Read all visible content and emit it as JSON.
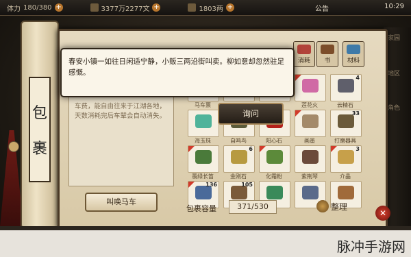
{
  "status": {
    "power_label": "体力",
    "power_value": "180/380",
    "gold": "3377万2277文",
    "gems": "1803两",
    "notice": "公告",
    "time": "10:29"
  },
  "roll_title": [
    "包",
    "裹"
  ],
  "tooltip": "春安小镇一如往日闲适宁静，小贩三两沿街叫卖。柳如意却忽然驻足感慨。",
  "ask_button": "询问",
  "item_desc": "车费，能自由往来于江湖各地，天数消耗完后车辇会自动消失。",
  "summon_button": "叫唤马车",
  "tabs": [
    {
      "label": "消耗",
      "color": "#b2433a"
    },
    {
      "label": "书",
      "color": "#7c4d2a"
    },
    {
      "label": "材料",
      "color": "#3f7aa8"
    }
  ],
  "items": [
    {
      "name": "马车票",
      "count": "",
      "new": true,
      "color": "#c8a15a"
    },
    {
      "name": "",
      "count": "",
      "new": true,
      "color": "#c04a6b"
    },
    {
      "name": "",
      "count": "",
      "new": false,
      "color": "#5a4a3a"
    },
    {
      "name": "莲花火",
      "count": "",
      "new": true,
      "color": "#d06aa5"
    },
    {
      "name": "云精石",
      "count": "4",
      "new": false,
      "color": "#5f5f6b"
    },
    {
      "name": "海玉珠",
      "count": "",
      "new": false,
      "color": "#4fb39a"
    },
    {
      "name": "自鸣鸟",
      "count": "",
      "new": true,
      "color": "#5b5b3a"
    },
    {
      "name": "阳心石",
      "count": "",
      "new": false,
      "color": "#b3201a"
    },
    {
      "name": "画墨",
      "count": "",
      "new": true,
      "color": "#a48a6a"
    },
    {
      "name": "打磨器具",
      "count": "33",
      "new": false,
      "color": "#6b5a3a"
    },
    {
      "name": "翡绿长笛",
      "count": "",
      "new": true,
      "color": "#4a7a3a"
    },
    {
      "name": "金刚石",
      "count": "6",
      "new": false,
      "color": "#b79a40"
    },
    {
      "name": "化霜粉",
      "count": "",
      "new": true,
      "color": "#5c8a3a"
    },
    {
      "name": "紫荆琴",
      "count": "",
      "new": false,
      "color": "#6b4a3a"
    },
    {
      "name": "介晶",
      "count": "3",
      "new": true,
      "color": "#c7a04a"
    },
    {
      "name": "",
      "count": "136",
      "new": true,
      "color": "#4a6a9a"
    },
    {
      "name": "",
      "count": "105",
      "new": false,
      "color": "#7a5a3a"
    },
    {
      "name": "",
      "count": "",
      "new": false,
      "color": "#3a8a5a"
    },
    {
      "name": "",
      "count": "",
      "new": false,
      "color": "#5a6a8a"
    },
    {
      "name": "",
      "count": "",
      "new": false,
      "color": "#a06a3a"
    }
  ],
  "capacity_label": "包裹容量",
  "capacity_value": "371/530",
  "sort_button": "整理",
  "side_labels": [
    "家园",
    "地区",
    "角色"
  ],
  "watermark": "脉冲手游网"
}
